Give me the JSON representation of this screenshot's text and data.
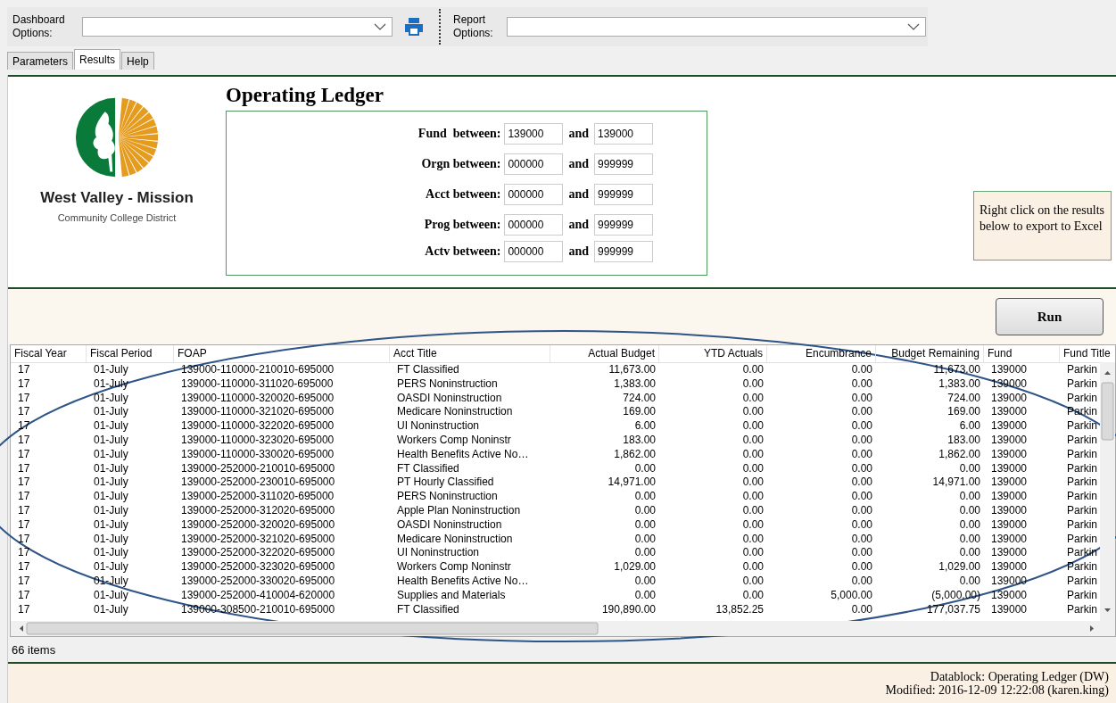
{
  "toolbar": {
    "dashboard_label": "Dashboard Options:",
    "report_label": "Report Options:"
  },
  "tabs": [
    {
      "label": "Parameters",
      "selected": false
    },
    {
      "label": "Results",
      "selected": true
    },
    {
      "label": "Help",
      "selected": false
    }
  ],
  "logo": {
    "name": "West Valley - Mission",
    "subtitle": "Community College District"
  },
  "title": "Operating Ledger",
  "parameters": [
    {
      "label": "Fund  between:",
      "from": "139000",
      "joiner": "and",
      "to": "139000"
    },
    {
      "label": "Orgn between:",
      "from": "000000",
      "joiner": "and",
      "to": "999999"
    },
    {
      "label": "Acct between:",
      "from": "000000",
      "joiner": "and",
      "to": "999999"
    },
    {
      "label": "Prog between:",
      "from": "000000",
      "joiner": "and",
      "to": "999999"
    },
    {
      "label": "Actv between:",
      "from": "000000",
      "joiner": "and",
      "to": "999999"
    }
  ],
  "note": "Right click on the results below to export to Excel",
  "run_button": "Run",
  "table": {
    "columns": [
      {
        "label": "Fiscal Year",
        "kind": "text"
      },
      {
        "label": "Fiscal Period",
        "kind": "text"
      },
      {
        "label": "FOAP",
        "kind": "text"
      },
      {
        "label": "Acct Title",
        "kind": "text"
      },
      {
        "label": "Actual Budget",
        "kind": "number"
      },
      {
        "label": "YTD Actuals",
        "kind": "number"
      },
      {
        "label": "Encumbrance",
        "kind": "number"
      },
      {
        "label": "Budget Remaining",
        "kind": "number"
      },
      {
        "label": "Fund",
        "kind": "text"
      },
      {
        "label": "Fund Title",
        "kind": "text"
      }
    ],
    "rows": [
      [
        "17",
        "01-July",
        "139000-110000-210010-695000",
        "FT Classified",
        "11,673.00",
        "0.00",
        "0.00",
        "11,673.00",
        "139000",
        "Parkin"
      ],
      [
        "17",
        "01-July",
        "139000-110000-311020-695000",
        "PERS Noninstruction",
        "1,383.00",
        "0.00",
        "0.00",
        "1,383.00",
        "139000",
        "Parkin"
      ],
      [
        "17",
        "01-July",
        "139000-110000-320020-695000",
        "OASDI Noninstruction",
        "724.00",
        "0.00",
        "0.00",
        "724.00",
        "139000",
        "Parkin"
      ],
      [
        "17",
        "01-July",
        "139000-110000-321020-695000",
        "Medicare Noninstruction",
        "169.00",
        "0.00",
        "0.00",
        "169.00",
        "139000",
        "Parkin"
      ],
      [
        "17",
        "01-July",
        "139000-110000-322020-695000",
        "UI Noninstruction",
        "6.00",
        "0.00",
        "0.00",
        "6.00",
        "139000",
        "Parkin"
      ],
      [
        "17",
        "01-July",
        "139000-110000-323020-695000",
        "Workers Comp Noninstr",
        "183.00",
        "0.00",
        "0.00",
        "183.00",
        "139000",
        "Parkin"
      ],
      [
        "17",
        "01-July",
        "139000-110000-330020-695000",
        "Health Benefits Active No…",
        "1,862.00",
        "0.00",
        "0.00",
        "1,862.00",
        "139000",
        "Parkin"
      ],
      [
        "17",
        "01-July",
        "139000-252000-210010-695000",
        "FT Classified",
        "0.00",
        "0.00",
        "0.00",
        "0.00",
        "139000",
        "Parkin"
      ],
      [
        "17",
        "01-July",
        "139000-252000-230010-695000",
        "PT Hourly Classified",
        "14,971.00",
        "0.00",
        "0.00",
        "14,971.00",
        "139000",
        "Parkin"
      ],
      [
        "17",
        "01-July",
        "139000-252000-311020-695000",
        "PERS Noninstruction",
        "0.00",
        "0.00",
        "0.00",
        "0.00",
        "139000",
        "Parkin"
      ],
      [
        "17",
        "01-July",
        "139000-252000-312020-695000",
        "Apple Plan Noninstruction",
        "0.00",
        "0.00",
        "0.00",
        "0.00",
        "139000",
        "Parkin"
      ],
      [
        "17",
        "01-July",
        "139000-252000-320020-695000",
        "OASDI Noninstruction",
        "0.00",
        "0.00",
        "0.00",
        "0.00",
        "139000",
        "Parkin"
      ],
      [
        "17",
        "01-July",
        "139000-252000-321020-695000",
        "Medicare Noninstruction",
        "0.00",
        "0.00",
        "0.00",
        "0.00",
        "139000",
        "Parkin"
      ],
      [
        "17",
        "01-July",
        "139000-252000-322020-695000",
        "UI Noninstruction",
        "0.00",
        "0.00",
        "0.00",
        "0.00",
        "139000",
        "Parkin"
      ],
      [
        "17",
        "01-July",
        "139000-252000-323020-695000",
        "Workers Comp Noninstr",
        "1,029.00",
        "0.00",
        "0.00",
        "1,029.00",
        "139000",
        "Parkin"
      ],
      [
        "17",
        "01-July",
        "139000-252000-330020-695000",
        "Health Benefits Active No…",
        "0.00",
        "0.00",
        "0.00",
        "0.00",
        "139000",
        "Parkin"
      ],
      [
        "17",
        "01-July",
        "139000-252000-410004-620000",
        "Supplies and Materials",
        "0.00",
        "0.00",
        "5,000.00",
        "(5,000.00)",
        "139000",
        "Parkin"
      ],
      [
        "17",
        "01-July",
        "139000-308500-210010-695000",
        "FT Classified",
        "190,890.00",
        "13,852.25",
        "0.00",
        "177,037.75",
        "139000",
        "Parkin"
      ]
    ]
  },
  "status_bar": "66 items",
  "footer": [
    "Datablock: Operating Ledger (DW)",
    "Modified: 2016-12-09 12:22:08 (karen.king)"
  ]
}
